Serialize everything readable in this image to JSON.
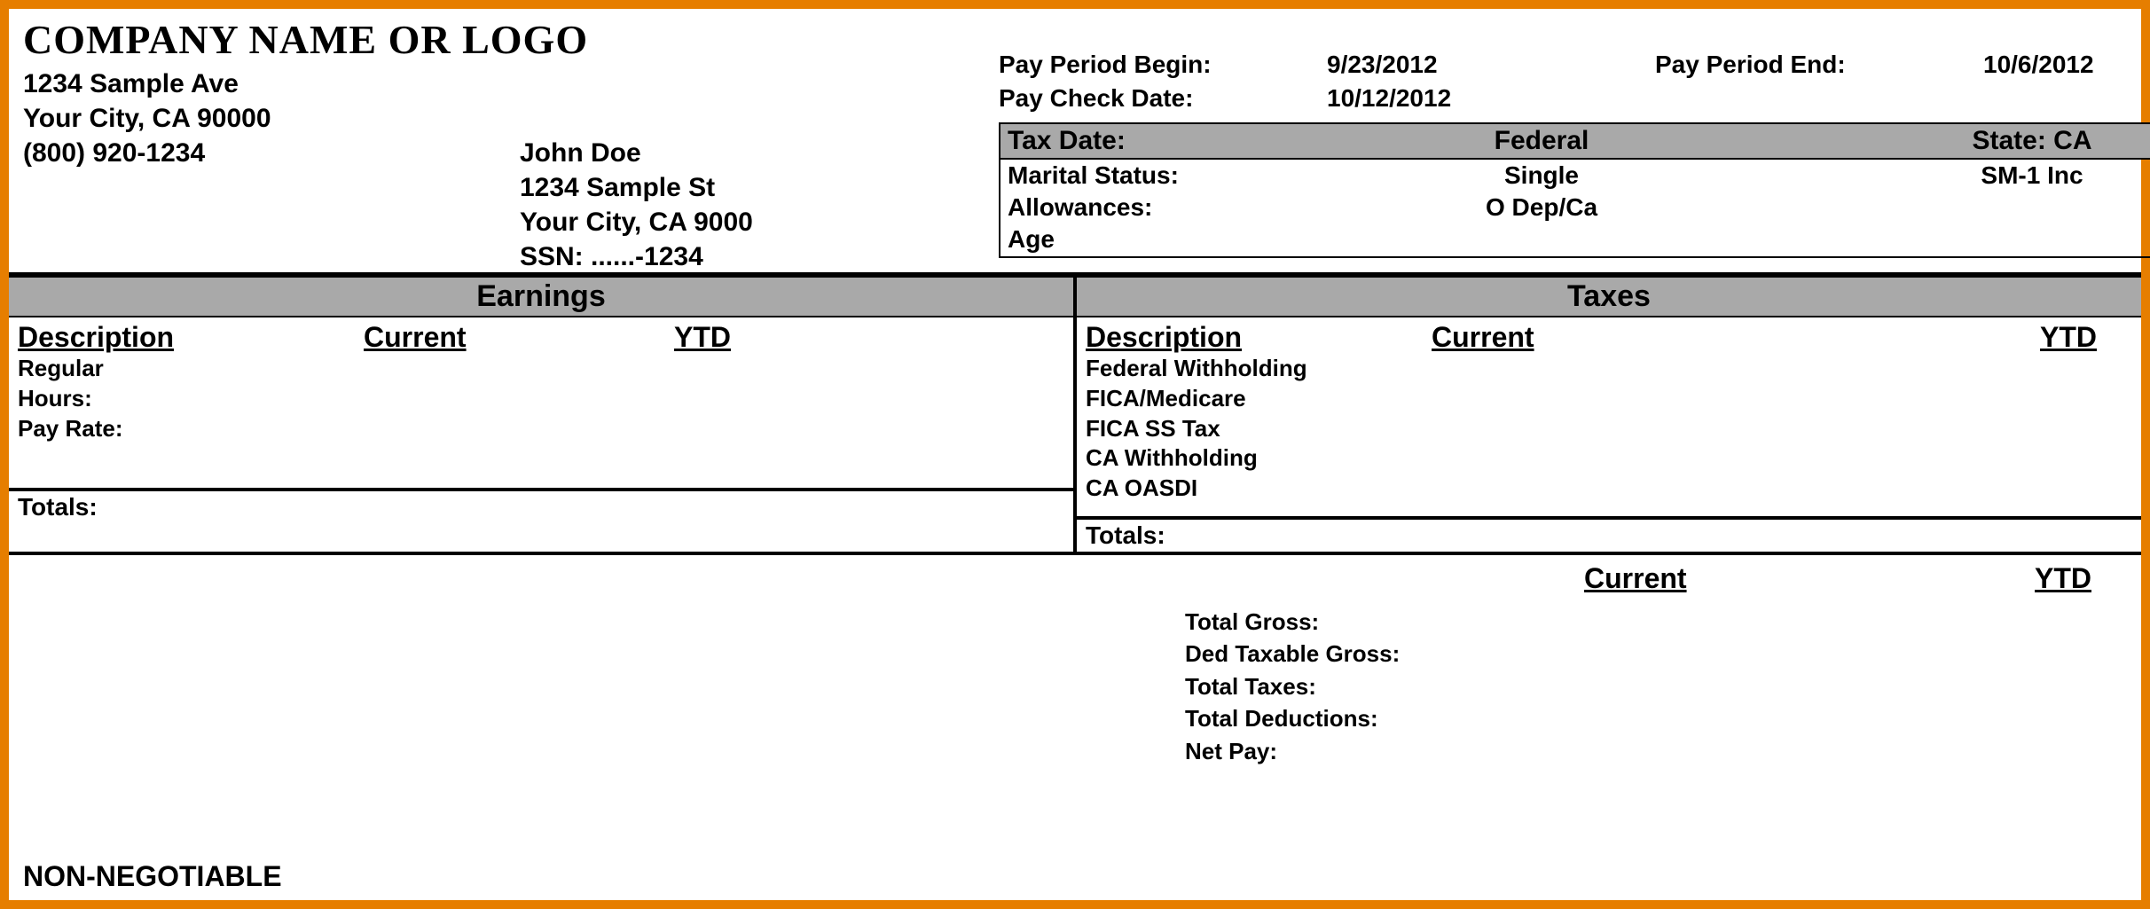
{
  "company": {
    "name": "COMPANY NAME OR LOGO",
    "address1": "1234 Sample Ave",
    "address2": "Your City, CA 90000",
    "phone": "(800) 920-1234"
  },
  "employee": {
    "name": "John Doe",
    "address1": "1234 Sample St",
    "address2": "Your City, CA 9000",
    "ssn": "SSN: ......-1234"
  },
  "period": {
    "begin_label": "Pay Period Begin:",
    "begin_value": "9/23/2012",
    "end_label": "Pay Period End:",
    "end_value": "10/6/2012",
    "check_label": "Pay Check Date:",
    "check_value": "10/12/2012"
  },
  "tax_info": {
    "head": {
      "c1": "Tax Date:",
      "c2": "Federal",
      "c3": "State: CA"
    },
    "rows": [
      {
        "c1": "Marital Status:",
        "c2": "Single",
        "c3": "SM-1 Inc"
      },
      {
        "c1": "Allowances:",
        "c2": "O Dep/Ca",
        "c3": ""
      },
      {
        "c1": "Age",
        "c2": "",
        "c3": ""
      }
    ]
  },
  "earnings": {
    "title": "Earnings",
    "head": {
      "desc": "Description",
      "current": "Current",
      "ytd": "YTD"
    },
    "items": [
      "Regular",
      "Hours:",
      "Pay Rate:"
    ],
    "totals": "Totals:"
  },
  "taxes": {
    "title": "Taxes",
    "head": {
      "desc": "Description",
      "current": "Current",
      "ytd": "YTD"
    },
    "items": [
      "Federal Withholding",
      "FICA/Medicare",
      "FICA SS Tax",
      "CA Withholding",
      "CA OASDI"
    ],
    "totals": "Totals:"
  },
  "summary": {
    "head": {
      "current": "Current",
      "ytd": "YTD"
    },
    "rows": [
      "Total Gross:",
      "Ded Taxable Gross:",
      "Total Taxes:",
      "Total Deductions:",
      "Net Pay:"
    ]
  },
  "footer": {
    "nonnegotiable": "NON-NEGOTIABLE"
  }
}
